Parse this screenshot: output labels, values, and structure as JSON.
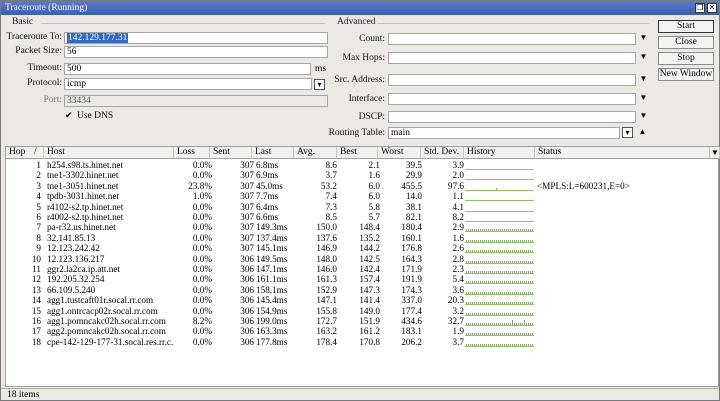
{
  "window": {
    "title": "Traceroute (Running)",
    "restore_label": "❐",
    "close_label": "✕"
  },
  "basic": {
    "label": "Basic",
    "traceroute_to_label": "Traceroute To:",
    "traceroute_to": "142.129.177.31",
    "packet_size_label": "Packet Size:",
    "packet_size": "56",
    "timeout_label": "Timeout:",
    "timeout": "500",
    "timeout_unit": "ms",
    "protocol_label": "Protocol:",
    "protocol": "icmp",
    "port_label": "Port:",
    "port": "33434",
    "use_dns_label": "Use DNS",
    "use_dns_checked": "✔"
  },
  "advanced": {
    "label": "Advanced",
    "count_label": "Count:",
    "count": "",
    "max_hops_label": "Max Hops:",
    "max_hops": "",
    "src_address_label": "Src. Address:",
    "src_address": "",
    "interface_label": "Interface:",
    "interface": "",
    "dscp_label": "DSCP:",
    "dscp": "",
    "routing_table_label": "Routing Table:",
    "routing_table": "main"
  },
  "buttons": {
    "start": "Start",
    "close": "Close",
    "stop": "Stop",
    "new_window": "New Window"
  },
  "table": {
    "columns": {
      "hop": "Hop",
      "sort": "/",
      "host": "Host",
      "loss": "Loss",
      "sent": "Sent",
      "last": "Last",
      "avg": "Avg.",
      "best": "Best",
      "worst": "Worst",
      "stddev": "Std. Dev.",
      "history": "History",
      "status": "Status"
    },
    "rows": [
      {
        "hop": "1",
        "host": "h254.s98.ts.hinet.net",
        "loss": "0.0%",
        "sent": "307",
        "last": "6.8ms",
        "avg": "8.6",
        "best": "2.1",
        "worst": "39.5",
        "stddev": "3.9",
        "status": "",
        "hist": [
          0
        ]
      },
      {
        "hop": "2",
        "host": "tne1-3302.hinet.net",
        "loss": "0.0%",
        "sent": "307",
        "last": "6.9ms",
        "avg": "3.7",
        "best": "1.6",
        "worst": "29.9",
        "stddev": "2.0",
        "status": "",
        "hist": [
          0
        ]
      },
      {
        "hop": "3",
        "host": "tne1-3051.hinet.net",
        "loss": "23.8%",
        "sent": "307",
        "last": "45.0ms",
        "avg": "53.2",
        "best": "6.0",
        "worst": "455.5",
        "stddev": "97.6",
        "status": "<MPLS:L=600231,E=0>",
        "hist": [
          0.15
        ]
      },
      {
        "hop": "4",
        "host": "tpdb-3031.hinet.net",
        "loss": "1.0%",
        "sent": "307",
        "last": "7.7ms",
        "avg": "7.4",
        "best": "6.0",
        "worst": "14.0",
        "stddev": "1.1",
        "status": "",
        "hist": [
          0
        ]
      },
      {
        "hop": "5",
        "host": "r4102-s2.tp.hinet.net",
        "loss": "0.0%",
        "sent": "307",
        "last": "6.4ms",
        "avg": "7.3",
        "best": "5.8",
        "worst": "38.1",
        "stddev": "4.1",
        "status": "",
        "hist": [
          0
        ]
      },
      {
        "hop": "6",
        "host": "r4002-s2.tp.hinet.net",
        "loss": "0.0%",
        "sent": "307",
        "last": "6.6ms",
        "avg": "8.5",
        "best": "5.7",
        "worst": "82.1",
        "stddev": "8.2",
        "status": "",
        "hist": [
          0
        ]
      },
      {
        "hop": "7",
        "host": "pa-r32.us.hinet.net",
        "loss": "0.0%",
        "sent": "307",
        "last": "149.3ms",
        "avg": "150.0",
        "best": "148.4",
        "worst": "180.4",
        "stddev": "2.9",
        "status": "",
        "hist": [
          0.35
        ]
      },
      {
        "hop": "8",
        "host": "32.141.85.13",
        "loss": "0.0%",
        "sent": "307",
        "last": "137.4ms",
        "avg": "137.6",
        "best": "135.2",
        "worst": "160.1",
        "stddev": "1.6",
        "status": "",
        "hist": [
          0.3
        ]
      },
      {
        "hop": "9",
        "host": "12.123.242.42",
        "loss": "0.0%",
        "sent": "307",
        "last": "145.1ms",
        "avg": "146.9",
        "best": "144.2",
        "worst": "176.8",
        "stddev": "2.6",
        "status": "",
        "hist": [
          0.33
        ]
      },
      {
        "hop": "10",
        "host": "12.123.136.217",
        "loss": "0.0%",
        "sent": "306",
        "last": "149.5ms",
        "avg": "148.0",
        "best": "142.5",
        "worst": "164.3",
        "stddev": "2.8",
        "status": "",
        "hist": [
          0.34
        ]
      },
      {
        "hop": "11",
        "host": "ggr2.la2ca.ip.att.net",
        "loss": "0.0%",
        "sent": "306",
        "last": "147.1ms",
        "avg": "146.0",
        "best": "142.4",
        "worst": "171.9",
        "stddev": "2.3",
        "status": "",
        "hist": [
          0.33
        ]
      },
      {
        "hop": "12",
        "host": "192.205.32.254",
        "loss": "0.0%",
        "sent": "306",
        "last": "161.1ms",
        "avg": "161.3",
        "best": "157.4",
        "worst": "191.9",
        "stddev": "5.4",
        "status": "",
        "hist": [
          0.36
        ]
      },
      {
        "hop": "13",
        "host": "66.109.5.240",
        "loss": "0.0%",
        "sent": "306",
        "last": "158.1ms",
        "avg": "152.9",
        "best": "147.3",
        "worst": "174.3",
        "stddev": "3.6",
        "status": "",
        "hist": [
          0.35
        ]
      },
      {
        "hop": "14",
        "host": "agg1.tustcaft01r.socal.rr.com",
        "loss": "0.0%",
        "sent": "306",
        "last": "145.4ms",
        "avg": "147.1",
        "best": "141.4",
        "worst": "337.0",
        "stddev": "20.3",
        "status": "",
        "hist": [
          0.34
        ]
      },
      {
        "hop": "15",
        "host": "agg1.ontrcacp02r.socal.rr.com",
        "loss": "0.0%",
        "sent": "306",
        "last": "154.9ms",
        "avg": "155.8",
        "best": "149.0",
        "worst": "177.4",
        "stddev": "3.2",
        "status": "",
        "hist": [
          0.36
        ]
      },
      {
        "hop": "16",
        "host": "agg1.pomncakc02h.socal.rr.com",
        "loss": "8.2%",
        "sent": "306",
        "last": "199.0ms",
        "avg": "172.7",
        "best": "151.9",
        "worst": "434.6",
        "stddev": "32.7",
        "status": "",
        "hist": [
          0.4
        ]
      },
      {
        "hop": "17",
        "host": "agg2.pomncakc02h.socal.rr.com",
        "loss": "0.0%",
        "sent": "306",
        "last": "163.3ms",
        "avg": "163.2",
        "best": "161.2",
        "worst": "183.1",
        "stddev": "1.9",
        "status": "",
        "hist": [
          0.37
        ]
      },
      {
        "hop": "18",
        "host": "cpe-142-129-177-31.socal.res.rr.c...",
        "loss": "0.0%",
        "sent": "306",
        "last": "177.8ms",
        "avg": "178.4",
        "best": "170.8",
        "worst": "206.2",
        "stddev": "3.7",
        "status": "",
        "hist": [
          0.4
        ]
      }
    ]
  },
  "status_bar": {
    "items_count": "18 items"
  },
  "colors": {
    "accent": "#316ac5",
    "title": "#3d5fb0",
    "history": "#7fb35a"
  }
}
